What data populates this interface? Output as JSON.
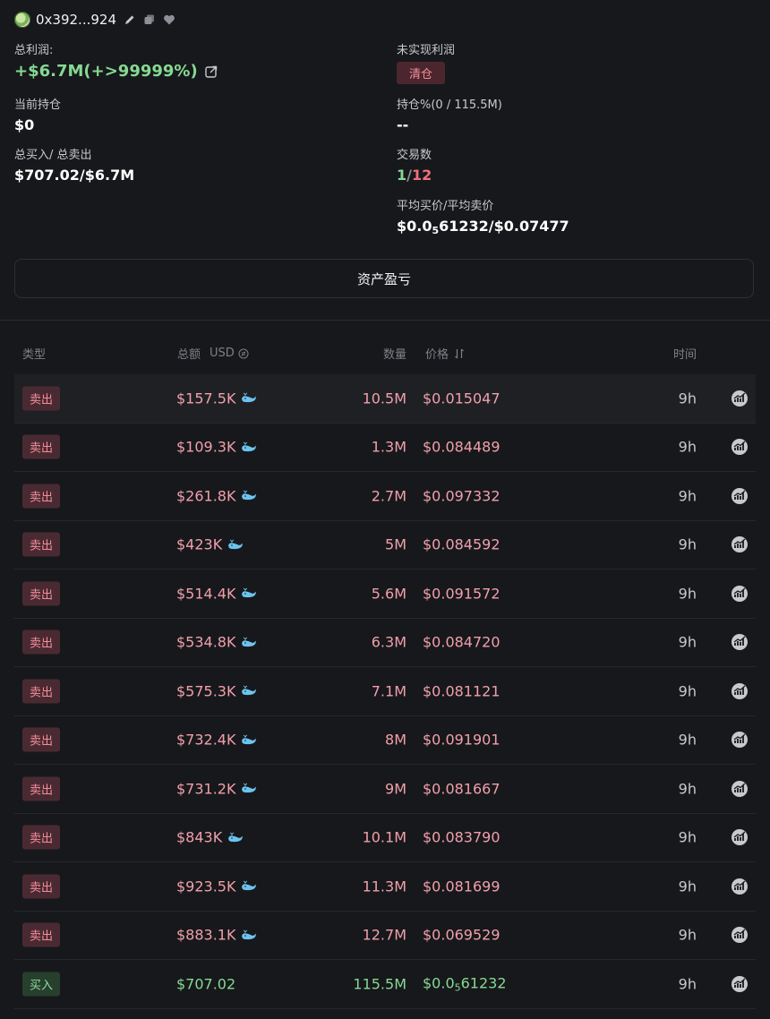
{
  "wallet": {
    "address": "0x392...924",
    "icons": [
      "avatar",
      "edit-icon",
      "copy-icon",
      "favorite-heart-icon"
    ]
  },
  "stats": {
    "total_profit_label": "总利润:",
    "total_profit_value": "+$6.7M(+>99999%)",
    "unrealized_label": "未实现利润",
    "unrealized_badge": "清仓",
    "holding_label": "当前持仓",
    "holding_value": "$0",
    "holding_pct_label": "持仓%(0 / 115.5M)",
    "holding_pct_value": "--",
    "buy_sell_label": "总买入/ 总卖出",
    "buy_sell_value": "$707.02/$6.7M",
    "trades_label": "交易数",
    "trades_buy": "1",
    "trades_sep": "/",
    "trades_sell": "12",
    "avg_label": "平均买价/平均卖价",
    "avg_prefix": "$0.0",
    "avg_sub": "5",
    "avg_rest": "61232/$0.07477"
  },
  "asset_button": "资产盈亏",
  "table": {
    "headers": {
      "type": "类型",
      "total": "总额",
      "currency": "USD",
      "qty": "数量",
      "price": "价格",
      "time": "时间"
    },
    "rows": [
      {
        "type": "卖出",
        "side": "sell",
        "total": "$157.5K",
        "whale": true,
        "qty": "10.5M",
        "price": "$0.015047",
        "time": "9h"
      },
      {
        "type": "卖出",
        "side": "sell",
        "total": "$109.3K",
        "whale": true,
        "qty": "1.3M",
        "price": "$0.084489",
        "time": "9h"
      },
      {
        "type": "卖出",
        "side": "sell",
        "total": "$261.8K",
        "whale": true,
        "qty": "2.7M",
        "price": "$0.097332",
        "time": "9h"
      },
      {
        "type": "卖出",
        "side": "sell",
        "total": "$423K",
        "whale": true,
        "qty": "5M",
        "price": "$0.084592",
        "time": "9h"
      },
      {
        "type": "卖出",
        "side": "sell",
        "total": "$514.4K",
        "whale": true,
        "qty": "5.6M",
        "price": "$0.091572",
        "time": "9h"
      },
      {
        "type": "卖出",
        "side": "sell",
        "total": "$534.8K",
        "whale": true,
        "qty": "6.3M",
        "price": "$0.084720",
        "time": "9h"
      },
      {
        "type": "卖出",
        "side": "sell",
        "total": "$575.3K",
        "whale": true,
        "qty": "7.1M",
        "price": "$0.081121",
        "time": "9h"
      },
      {
        "type": "卖出",
        "side": "sell",
        "total": "$732.4K",
        "whale": true,
        "qty": "8M",
        "price": "$0.091901",
        "time": "9h"
      },
      {
        "type": "卖出",
        "side": "sell",
        "total": "$731.2K",
        "whale": true,
        "qty": "9M",
        "price": "$0.081667",
        "time": "9h"
      },
      {
        "type": "卖出",
        "side": "sell",
        "total": "$843K",
        "whale": true,
        "qty": "10.1M",
        "price": "$0.083790",
        "time": "9h"
      },
      {
        "type": "卖出",
        "side": "sell",
        "total": "$923.5K",
        "whale": true,
        "qty": "11.3M",
        "price": "$0.081699",
        "time": "9h"
      },
      {
        "type": "卖出",
        "side": "sell",
        "total": "$883.1K",
        "whale": true,
        "qty": "12.7M",
        "price": "$0.069529",
        "time": "9h"
      },
      {
        "type": "买入",
        "side": "buy",
        "total": "$707.02",
        "whale": false,
        "qty": "115.5M",
        "price_prefix": "$0.0",
        "price_sub": "5",
        "price_rest": "61232",
        "time": "9h"
      }
    ]
  },
  "colors": {
    "background": "#17181b",
    "profit_green": "#86d993",
    "sell_red": "#f0707f",
    "sell_badge_bg": "#4a2a32",
    "buy_badge_bg": "#26402d",
    "whale_blue": "#5fb8e6"
  }
}
